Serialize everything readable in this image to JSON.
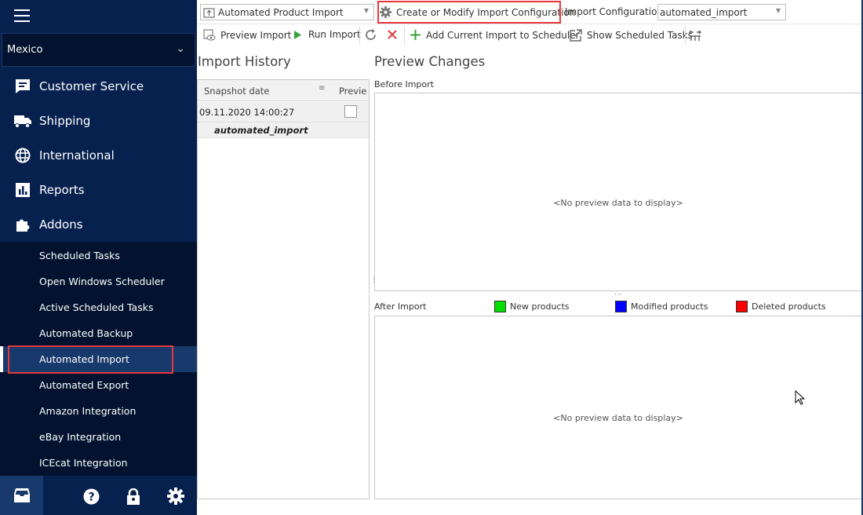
{
  "sidebar": {
    "store": "Mexico",
    "nav": [
      {
        "label": "Customer Service",
        "icon": "chat-icon"
      },
      {
        "label": "Shipping",
        "icon": "truck-icon"
      },
      {
        "label": "International",
        "icon": "globe-icon"
      },
      {
        "label": "Reports",
        "icon": "bar-chart-icon"
      },
      {
        "label": "Addons",
        "icon": "puzzle-icon"
      }
    ],
    "sub_items": [
      "Scheduled Tasks",
      "Open Windows Scheduler",
      "Active Scheduled Tasks",
      "Automated Backup",
      "Automated Import",
      "Automated Export",
      "Amazon Integration",
      "eBay Integration",
      "ICEcat Integration"
    ],
    "active_sub": "Automated Import"
  },
  "toolbar": {
    "import_type": "Automated Product Import",
    "create_modify": "Create or Modify Import Configuration",
    "config_label": "Import Configuration",
    "config_value": "automated_import",
    "preview_import": "Preview Import",
    "run_import": "Run Import",
    "add_scheduler": "Add Current Import to Scheduler",
    "show_tasks": "Show Scheduled Tasks"
  },
  "history": {
    "title": "Import History",
    "columns": [
      "Snapshot date",
      "Previe"
    ],
    "rows": [
      {
        "date": "09.11.2020 14:00:27",
        "preview": false,
        "group": "automated_import"
      }
    ]
  },
  "preview": {
    "title": "Preview Changes",
    "before_label": "Before Import",
    "after_label": "After Import",
    "no_data": "<No preview data to display>",
    "legend": [
      {
        "label": "New products",
        "color": "#00e000"
      },
      {
        "label": "Modified products",
        "color": "#0000ff"
      },
      {
        "label": "Deleted products",
        "color": "#ff0000"
      }
    ]
  },
  "colors": {
    "sidebar_bg": "#07214f",
    "submenu_bg": "#03132f",
    "active_bg": "#17396b",
    "highlight": "#e5393c"
  }
}
